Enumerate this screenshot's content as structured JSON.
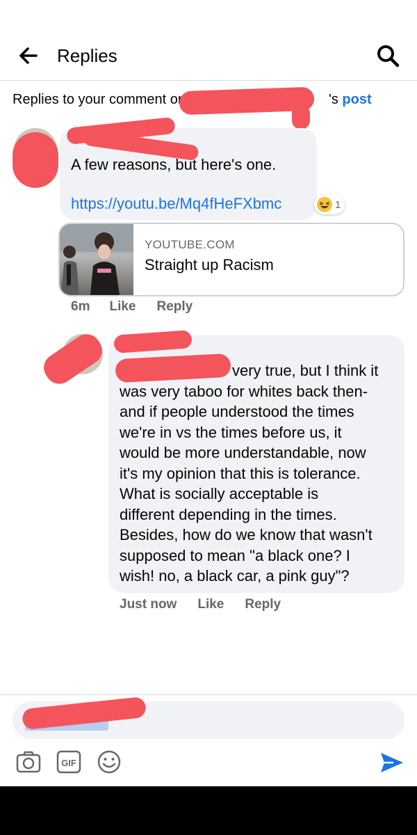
{
  "header": {
    "title": "Replies",
    "back_icon": "arrow-left-icon",
    "search_icon": "search-icon"
  },
  "context": {
    "prefix": "Replies to your comment on",
    "suffix": "'s",
    "post_link": "post"
  },
  "comments": [
    {
      "text": "A few reasons, but here's one.",
      "link": "https://youtu.be/Mq4fHeFXbmc",
      "reaction": {
        "icon": "laughing-emoji-icon",
        "count": "1"
      },
      "preview": {
        "domain": "YOUTUBE.COM",
        "title": "Straight up Racism"
      },
      "actions": {
        "time": "6m",
        "like": "Like",
        "reply": "Reply"
      }
    },
    {
      "text_lines": [
        "very true, but I think it",
        "was very taboo for whites back then-",
        "and if people understood the times",
        "we're in vs the times before us, it",
        "would be more understandable, now",
        "it's my opinion that this is tolerance.",
        "What is socially acceptable is",
        "different depending in the times.",
        "Besides, how do we know that wasn't",
        "supposed to mean \"a black one? I",
        "wish! no, a black car, a pink guy\"?"
      ],
      "actions": {
        "time": "Just now",
        "like": "Like",
        "reply": "Reply"
      }
    }
  ],
  "composer": {
    "camera_icon": "camera-icon",
    "gif_label": "GIF",
    "emoji_icon": "smiley-icon",
    "send_icon": "send-icon"
  },
  "colors": {
    "accent": "#1b74e4",
    "bubble": "#f0f2f5",
    "secondary_text": "#65676b",
    "redaction": "#f4545c"
  }
}
